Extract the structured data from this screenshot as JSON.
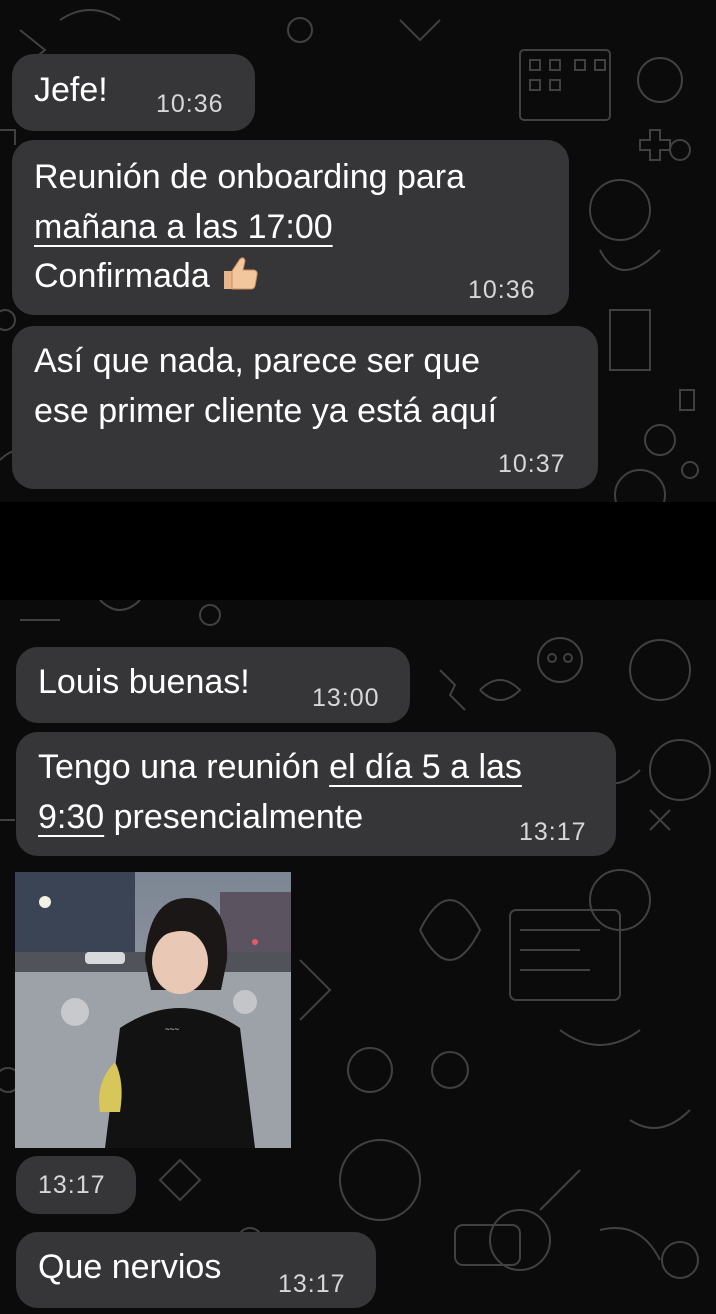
{
  "screenshot_top": {
    "messages": [
      {
        "text": "Jefe!",
        "time": "10:36"
      },
      {
        "line1": "Reunión de onboarding para",
        "line2": "mañana a las 17:00",
        "line3": "Confirmada",
        "emoji": "thumbs-up",
        "time": "10:36"
      },
      {
        "line1": "Así que nada, parece ser que",
        "line2": "ese primer cliente ya está aquí",
        "time": "10:37"
      }
    ]
  },
  "screenshot_bottom": {
    "messages": [
      {
        "text": "Louis buenas!",
        "time": "13:00"
      },
      {
        "line1_plain": "Tengo una reunión ",
        "line1_link": "el día 5 a las",
        "line2_link": "9:30",
        "line2_plain": " presencialmente",
        "time": "13:17"
      },
      {
        "type": "image",
        "description": "child-video-still",
        "time": "13:17"
      },
      {
        "text": "Que nervios",
        "time": "13:17"
      }
    ]
  },
  "colors": {
    "bubble": "#363638",
    "background": "#0b0b0b",
    "separator": "#000000"
  }
}
